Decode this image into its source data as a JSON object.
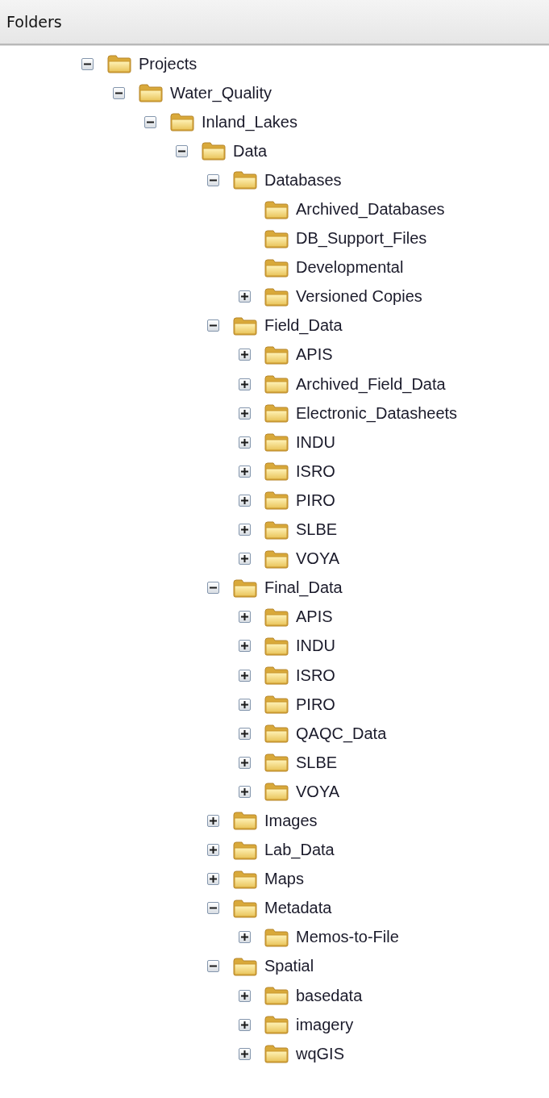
{
  "header": {
    "title": "Folders"
  },
  "tree": [
    {
      "label": "Projects",
      "expanded": true,
      "children": [
        {
          "label": "Water_Quality",
          "expanded": true,
          "children": [
            {
              "label": "Inland_Lakes",
              "expanded": true,
              "children": [
                {
                  "label": "Data",
                  "expanded": true,
                  "children": [
                    {
                      "label": "Databases",
                      "expanded": true,
                      "children": [
                        {
                          "label": "Archived_Databases"
                        },
                        {
                          "label": "DB_Support_Files"
                        },
                        {
                          "label": "Developmental"
                        },
                        {
                          "label": "Versioned Copies",
                          "expanded": false
                        }
                      ]
                    },
                    {
                      "label": "Field_Data",
                      "expanded": true,
                      "children": [
                        {
                          "label": "APIS",
                          "expanded": false
                        },
                        {
                          "label": "Archived_Field_Data",
                          "expanded": false
                        },
                        {
                          "label": "Electronic_Datasheets",
                          "expanded": false
                        },
                        {
                          "label": "INDU",
                          "expanded": false
                        },
                        {
                          "label": "ISRO",
                          "expanded": false
                        },
                        {
                          "label": "PIRO",
                          "expanded": false
                        },
                        {
                          "label": "SLBE",
                          "expanded": false
                        },
                        {
                          "label": "VOYA",
                          "expanded": false
                        }
                      ]
                    },
                    {
                      "label": "Final_Data",
                      "expanded": true,
                      "children": [
                        {
                          "label": "APIS",
                          "expanded": false
                        },
                        {
                          "label": "INDU",
                          "expanded": false
                        },
                        {
                          "label": "ISRO",
                          "expanded": false
                        },
                        {
                          "label": "PIRO",
                          "expanded": false
                        },
                        {
                          "label": "QAQC_Data",
                          "expanded": false
                        },
                        {
                          "label": "SLBE",
                          "expanded": false
                        },
                        {
                          "label": "VOYA",
                          "expanded": false
                        }
                      ]
                    },
                    {
                      "label": "Images",
                      "expanded": false
                    },
                    {
                      "label": "Lab_Data",
                      "expanded": false
                    },
                    {
                      "label": "Maps",
                      "expanded": false
                    },
                    {
                      "label": "Metadata",
                      "expanded": true,
                      "children": [
                        {
                          "label": "Memos-to-File",
                          "expanded": false
                        }
                      ]
                    },
                    {
                      "label": "Spatial",
                      "expanded": true,
                      "children": [
                        {
                          "label": "basedata",
                          "expanded": false
                        },
                        {
                          "label": "imagery",
                          "expanded": false
                        },
                        {
                          "label": "wqGIS",
                          "expanded": false
                        }
                      ]
                    }
                  ]
                }
              ]
            }
          ]
        }
      ]
    }
  ]
}
